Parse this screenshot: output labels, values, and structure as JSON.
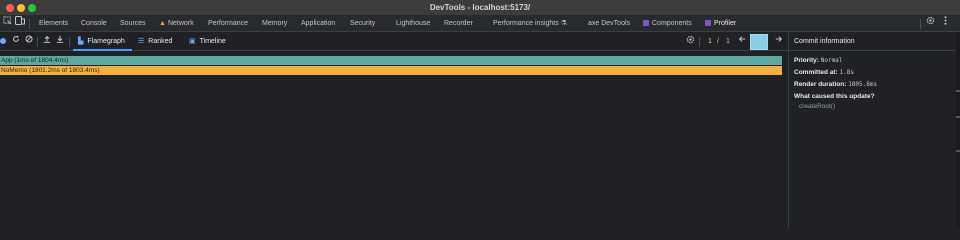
{
  "window": {
    "title": "DevTools - localhost:5173/"
  },
  "tabs": [
    {
      "label": "Elements"
    },
    {
      "label": "Console"
    },
    {
      "label": "Sources"
    },
    {
      "label": "Network"
    },
    {
      "label": "Performance"
    },
    {
      "label": "Memory"
    },
    {
      "label": "Application"
    },
    {
      "label": "Security"
    },
    {
      "label": "Lighthouse"
    },
    {
      "label": "Recorder"
    },
    {
      "label": "Performance insights"
    },
    {
      "label": "axe DevTools"
    },
    {
      "label": "Components"
    },
    {
      "label": "Profiler"
    }
  ],
  "profiler": {
    "views": {
      "flamegraph": "Flamegraph",
      "ranked": "Ranked",
      "timeline": "Timeline"
    },
    "commit_current": "1",
    "commit_separator": "/",
    "commit_total": "1",
    "commit_box_color": "#87ceeb"
  },
  "flamegraph": {
    "bars": [
      {
        "label": "App (1ms of 1804.4ms)",
        "color": "#5da8a0"
      },
      {
        "label": "NoMemo (1801.2ms of 1803.4ms)",
        "color": "#f5b042"
      }
    ]
  },
  "commit_info": {
    "heading": "Commit information",
    "priority_label": "Priority:",
    "priority_value": "Normal",
    "committed_label": "Committed at:",
    "committed_value": "1.8s",
    "render_label": "Render duration:",
    "render_value": "1805.8ms",
    "cause_label": "What caused this update?",
    "cause_value": "createRoot()"
  },
  "icons": {
    "inspect": "inspect-icon",
    "device": "device-toolbar-icon",
    "settings": "settings-gear-icon",
    "more": "more-vert-icon"
  }
}
